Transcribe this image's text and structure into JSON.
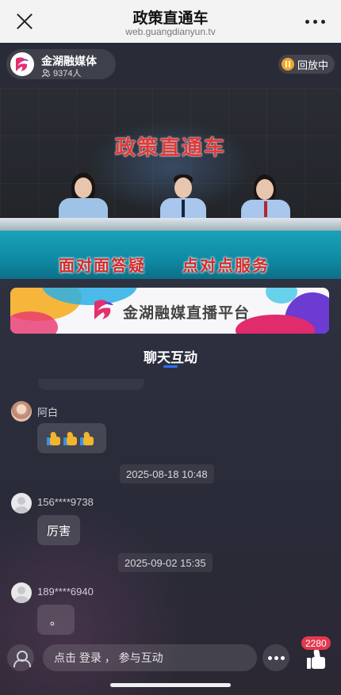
{
  "header": {
    "title": "政策直通车",
    "url": "web.guangdianyun.tv"
  },
  "channel": {
    "name": "金湖融媒体",
    "viewers": "9374人",
    "replay_label": "回放中"
  },
  "video": {
    "sign_text": "政策直通车",
    "slogan_left": "面对面答疑",
    "slogan_right": "点对点服务"
  },
  "banner": {
    "text": "金湖融媒直播平台"
  },
  "chat": {
    "tab_label": "聊天互动",
    "messages": [
      {
        "user": "阿白",
        "content": ""
      },
      {
        "user": "156****9738",
        "content": "厉害"
      },
      {
        "user": "189****6940",
        "content": "。"
      }
    ],
    "timestamps": [
      "2025-08-18 10:48",
      "2025-09-02 15:35"
    ]
  },
  "bottom": {
    "input_placeholder": "点击 登录 ， 参与互动",
    "like_count": "2280"
  },
  "colors": {
    "accent_blue": "#2a73ff",
    "like_badge": "#e5384f",
    "replay_dot": "#f5a623",
    "sign_red": "#e03a3a"
  }
}
